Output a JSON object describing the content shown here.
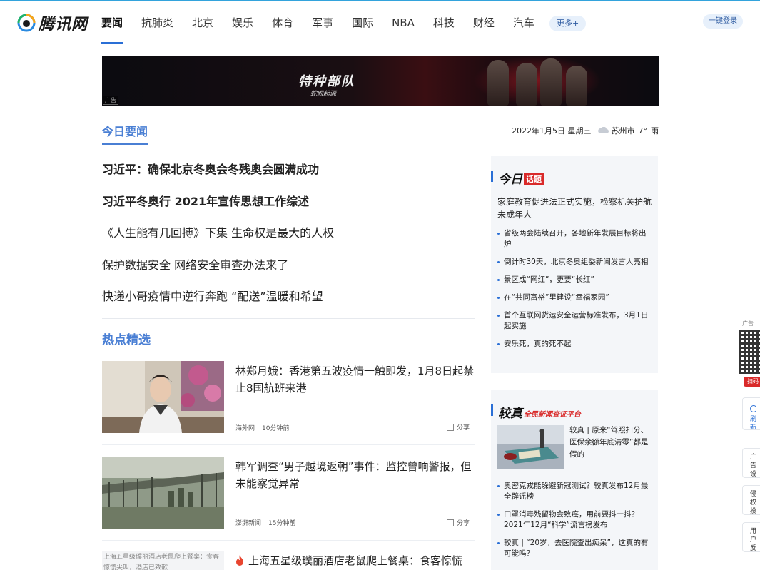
{
  "logo": {
    "text": "腾讯网"
  },
  "nav": {
    "items": [
      "要闻",
      "抗肺炎",
      "北京",
      "娱乐",
      "体育",
      "军事",
      "国际",
      "NBA",
      "科技",
      "财经",
      "汽车"
    ],
    "more_label": "更多+",
    "login_label": "一键登录"
  },
  "banner": {
    "title": "特种部队",
    "subtitle": "蛇眼起源",
    "ad_label": "广告"
  },
  "today": {
    "section_title": "今日要闻",
    "date": "2022年1月5日 星期三",
    "city": "苏州市",
    "temp": "7°",
    "weather": "雨",
    "headlines": [
      "习近平：确保北京冬奥会冬残奥会圆满成功",
      "习近平冬奥行 2021年宣传思想工作综述",
      "《人生能有几回搏》下集 生命权是最大的人权",
      "保护数据安全 网络安全审查办法来了",
      "快递小哥疫情中逆行奔跑 “配送”温暖和希望"
    ]
  },
  "hot": {
    "section_title": "热点精选",
    "share_label": "分享",
    "items": [
      {
        "title": "林郑月娥：香港第五波疫情一触即发，1月8日起禁止8国航班来港",
        "source": "海外网",
        "time": "10分钟前"
      },
      {
        "title": "韩军调查“男子越境返朝”事件：监控曾响警报，但未能察觉异常",
        "source": "澎湃新闻",
        "time": "15分钟前"
      },
      {
        "title": "上海五星级璞丽酒店老鼠爬上餐桌：食客惊慌",
        "img_caption": "上海五星级璞丽酒店老鼠爬上餐桌：食客惊慌尖叫，酒店已致歉"
      }
    ]
  },
  "topic": {
    "brand": "今日",
    "tag": "话题",
    "lead": "家庭教育促进法正式实施，检察机关护航未成年人",
    "items": [
      "省级两会陆续召开，各地新年发展目标将出炉",
      "倒计时30天，北京冬奥组委新闻发言人亮相",
      "景区成“网红”，更要“长红”",
      "在“共同富裕”里建设“幸福家园”",
      "首个互联网货运安全运营标准发布，3月1日起实施",
      "安乐死，真的死不起"
    ]
  },
  "fact": {
    "brand": "较真",
    "slogan": "全民新闻查证平台",
    "lead": "较真 | 原来“驾照扣分、医保余额年底清零”都是假的",
    "items": [
      "奥密克戎能躲避新冠测试？较真发布12月最全辟谣榜",
      "口罩消毒残留物会致癌，用前要抖一抖？2021年12月“科学”流言榜发布",
      "较真 | “20岁，去医院查出痴呆”，这真的有可能吗？"
    ]
  },
  "rail": {
    "ad_label": "广告",
    "qr_label": "扫码",
    "refresh_label": "刷新",
    "settings_label": "广告设置",
    "complaint_label": "侵权投诉",
    "feedback_label": "用户反馈"
  },
  "colors": {
    "accent": "#4a7fd4",
    "nav_active": "#2a6fd6",
    "brand_red": "#d92a2a"
  }
}
